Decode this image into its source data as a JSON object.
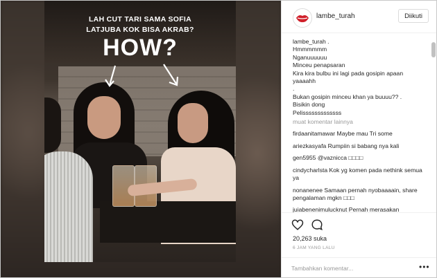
{
  "post": {
    "caption_line1": "LAH CUT TARI SAMA SOFIA",
    "caption_line2": "LATJUBA KOK BISA AKRAB?",
    "caption_big": "HOW?"
  },
  "header": {
    "username": "lambe_turah",
    "follow_label": "Diikuti"
  },
  "caption": {
    "user": "lambe_turah",
    "lines": [
      "lambe_turah .",
      "Hmmmmmm",
      "Nganuuuuuu",
      "Minceu penapsaran",
      "Kira kira bulbu ini lagi pada gosipin apaan",
      "yaaaahh",
      ".",
      "Bukan gosipin minceu khan ya buuuu?? .",
      "Bisikin dong",
      "Pelisssssssssssss"
    ]
  },
  "load_more": "muat komentar lainnya",
  "comments": [
    {
      "user": "firdaanitamawar",
      "text": "Maybe mau Tri some"
    },
    {
      "user": "ariezkasyafa",
      "text": "Rumpiin si babang nya kali"
    },
    {
      "user": "gen5955",
      "text": "@vaznicca □□□□"
    },
    {
      "user": "cindycharlsta",
      "text": "Kok yg komen pada nethink semua ya"
    },
    {
      "user": "nonanenee",
      "text": "Samaan pernah nyobaaaain, share pengalaman mgkn □□□"
    },
    {
      "user": "juiabenenimulucknut",
      "text": "Pernah merasakan"
    }
  ],
  "likes": "20,263 suka",
  "time": "6 JAM YANG LALU",
  "add_comment_placeholder": "Tambahkan komentar...",
  "more_options": "•••"
}
